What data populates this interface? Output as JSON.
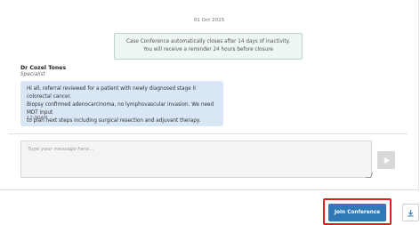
{
  "conversation": {
    "date": "01 Oct 2025",
    "system_note": {
      "line1": "Case Conference automatically closes after 14 days of inactivity.",
      "line2": "You will receive a reminder 24 hours before closure"
    },
    "message": {
      "sender_name": "Dr Cozel Tones",
      "sender_role": "Specialist",
      "lines": [
        "Hi all, referral reviewed for a patient with newly diagnosed stage II colorectal cancer.",
        "Biopsy confirmed adenocarcinoma, no lymphovascular invasion. We need MDT input",
        "to plan next steps including surgical resection and adjuvant therapy."
      ],
      "time": "12:00AM"
    }
  },
  "composer": {
    "placeholder": "Type your message here...",
    "send_icon": "send-arrow-icon"
  },
  "actions": {
    "join_label": "Join Conference",
    "download_icon": "download-icon",
    "highlight_color": "#e02020",
    "primary_color": "#2f79b7"
  }
}
